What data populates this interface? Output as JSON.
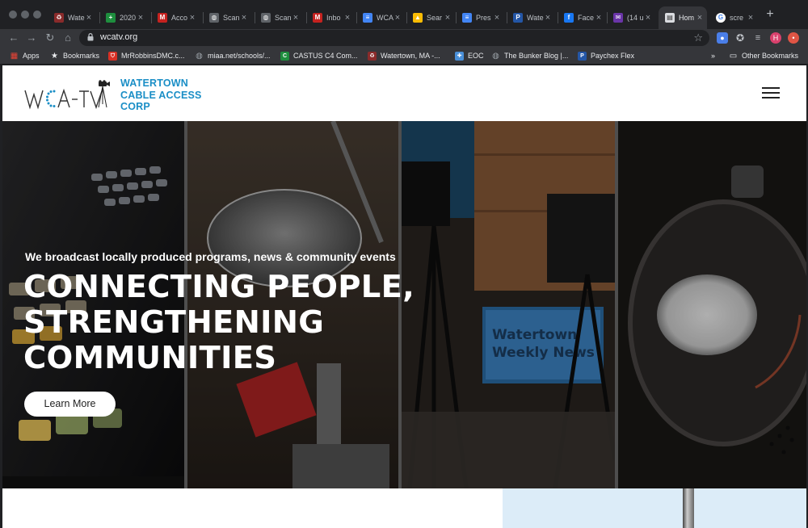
{
  "browser": {
    "tabs": [
      {
        "title": "Wate",
        "icon": "recycle-tab-icon",
        "color": "#8a2b2b",
        "active": false
      },
      {
        "title": "2020",
        "icon": "sheets-icon",
        "color": "#1e8e3e",
        "active": false
      },
      {
        "title": "Acco",
        "icon": "gmail-icon",
        "color": "#c5221f",
        "active": false
      },
      {
        "title": "Scan",
        "icon": "globe-icon",
        "color": "#5f6368",
        "active": false
      },
      {
        "title": "Scan",
        "icon": "globe-icon",
        "color": "#5f6368",
        "active": false
      },
      {
        "title": "Inbo",
        "icon": "gmail-icon",
        "color": "#c5221f",
        "active": false
      },
      {
        "title": "WCA",
        "icon": "docs-icon",
        "color": "#4285f4",
        "active": false
      },
      {
        "title": "Sear",
        "icon": "drive-icon",
        "color": "#fbbc04",
        "active": false
      },
      {
        "title": "Pres",
        "icon": "docs-icon",
        "color": "#4285f4",
        "active": false
      },
      {
        "title": "Wate",
        "icon": "paychex-icon",
        "color": "#2456a6",
        "active": false
      },
      {
        "title": "Face",
        "icon": "facebook-icon",
        "color": "#1877f2",
        "active": false
      },
      {
        "title": "(14 u",
        "icon": "mail-icon",
        "color": "#6a35a8",
        "active": false
      },
      {
        "title": "Hom",
        "icon": "page-icon",
        "color": "#dadce0",
        "active": true
      },
      {
        "title": "scre",
        "icon": "google-icon",
        "color": "#ffffff",
        "active": false
      }
    ],
    "url": "wcatv.org"
  },
  "bookmarks": [
    {
      "label": "Apps",
      "icon": "apps-grid-icon",
      "color": "#ea4335"
    },
    {
      "label": "Bookmarks",
      "icon": "star-icon",
      "color": "#e8eaed"
    },
    {
      "label": "MrRobbinsDMC.c...",
      "icon": "shield-icon",
      "color": "#d93025"
    },
    {
      "label": "miaa.net/schools/...",
      "icon": "globe-icon",
      "color": "#9aa0a6"
    },
    {
      "label": "CASTUS C4 Com...",
      "icon": "castus-icon",
      "color": "#1e8e3e"
    },
    {
      "label": "Watertown, MA -...",
      "icon": "recycle-icon",
      "color": "#8a2b2b"
    },
    {
      "label": "EOC",
      "icon": "eoc-icon",
      "color": "#4a90d9"
    },
    {
      "label": "The Bunker Blog |...",
      "icon": "globe-icon",
      "color": "#9aa0a6"
    },
    {
      "label": "Paychex Flex",
      "icon": "paychex-icon",
      "color": "#2456a6"
    },
    {
      "label": "»",
      "icon": "more-bookmarks-icon",
      "color": ""
    },
    {
      "label": "Other Bookmarks",
      "icon": "folder-icon",
      "color": "#e8eaed"
    }
  ],
  "site": {
    "logo_text": "WCA-TV",
    "org_lines": [
      "WATERTOWN",
      "CABLE ACCESS",
      "CORP"
    ],
    "brand_color": "#1a8ec6",
    "hero": {
      "tagline": "We broadcast locally produced programs, news & community events",
      "headline_lines": [
        "CONNECTING PEOPLE,",
        "STRENGTHENING",
        "COMMUNITIES"
      ],
      "cta": "Learn More",
      "studio_screen_text": [
        "Watertown",
        "Weekly News"
      ]
    }
  }
}
